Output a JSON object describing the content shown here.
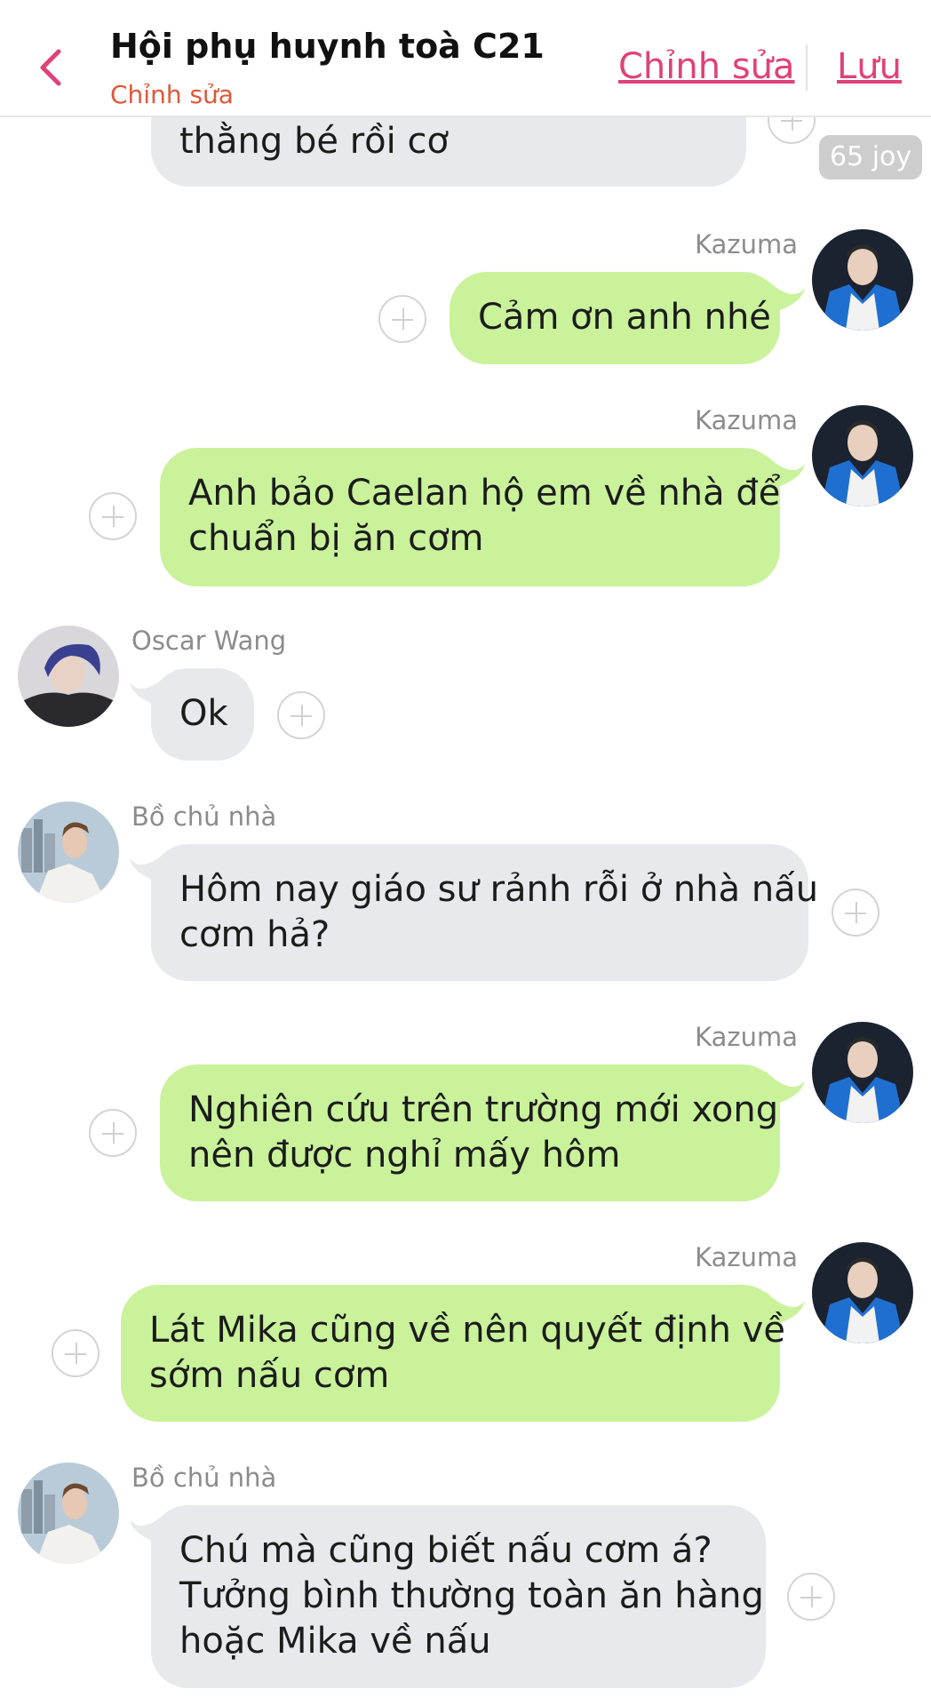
{
  "header": {
    "back_icon": "chevron-left-icon",
    "title": "Hội phụ huynh toà C21",
    "subtitle": "Chỉnh sửa",
    "edit_label": "Chỉnh sửa",
    "save_label": "Lưu",
    "accent_color": "#e0417a"
  },
  "top_partial": {
    "text": "thằng bé rồi cơ",
    "reaction_badge": "65 joy"
  },
  "messages": [
    {
      "sender": "Kazuma",
      "side": "right",
      "lines": [
        "Cảm ơn anh nhé"
      ]
    },
    {
      "sender": "Kazuma",
      "side": "right",
      "lines": [
        "Anh bảo Caelan hộ em về nhà để",
        "chuẩn bị ăn cơm"
      ]
    },
    {
      "sender": "Oscar Wang",
      "side": "left",
      "lines": [
        "Ok"
      ]
    },
    {
      "sender": "Bồ chủ nhà",
      "side": "left",
      "lines": [
        "Hôm nay giáo sư rảnh rỗi ở nhà nấu",
        "cơm hả?"
      ]
    },
    {
      "sender": "Kazuma",
      "side": "right",
      "lines": [
        "Nghiên cứu trên trường mới xong",
        "nên được nghỉ mấy hôm"
      ]
    },
    {
      "sender": "Kazuma",
      "side": "right",
      "lines": [
        "Lát Mika cũng về nên quyết định về",
        "sớm nấu cơm"
      ]
    },
    {
      "sender": "Bồ chủ nhà",
      "side": "left",
      "lines": [
        "Chú mà cũng biết nấu cơm á?",
        "Tưởng bình thường toàn ăn hàng",
        "hoặc Mika về nấu"
      ]
    }
  ],
  "colors": {
    "outgoing_bubble": "#c9f29b",
    "incoming_bubble": "#e7e9ec",
    "sender_name": "#8c8c8c",
    "subtitle": "#e0573a"
  }
}
